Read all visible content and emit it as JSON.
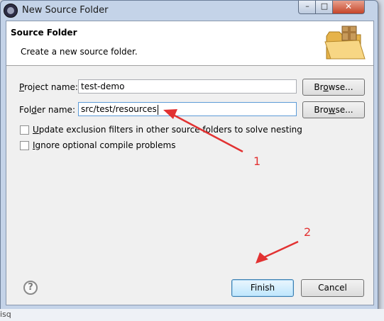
{
  "window": {
    "title": "New Source Folder",
    "controls": {
      "minimize": "–",
      "maximize": "□",
      "close": "✕"
    }
  },
  "banner": {
    "title": "Source Folder",
    "description": "Create a new source folder.",
    "icon": "folder-package-icon"
  },
  "form": {
    "project_label_mnemonic": "P",
    "project_label_rest": "roject name:",
    "project_value": "test-demo",
    "project_browse_pre": "Br",
    "project_browse_mnemonic": "o",
    "project_browse_post": "wse...",
    "folder_label_pre": "Fol",
    "folder_label_mnemonic": "d",
    "folder_label_post": "er name:",
    "folder_value": "src/test/resources",
    "folder_browse_pre": "Bro",
    "folder_browse_mnemonic": "w",
    "folder_browse_post": "se...",
    "update_mnemonic": "U",
    "update_rest": "pdate exclusion filters in other source folders to solve nesting",
    "update_checked": false,
    "ignore_mnemonic": "I",
    "ignore_rest": "gnore optional compile problems",
    "ignore_checked": false
  },
  "footer": {
    "help_icon": "question-mark-icon",
    "help_glyph": "?",
    "finish_label": "Finish",
    "cancel_label": "Cancel"
  },
  "annotations": {
    "label_1": "1",
    "label_2": "2",
    "color": "#e23232"
  },
  "background": {
    "partial_text": "isq"
  }
}
